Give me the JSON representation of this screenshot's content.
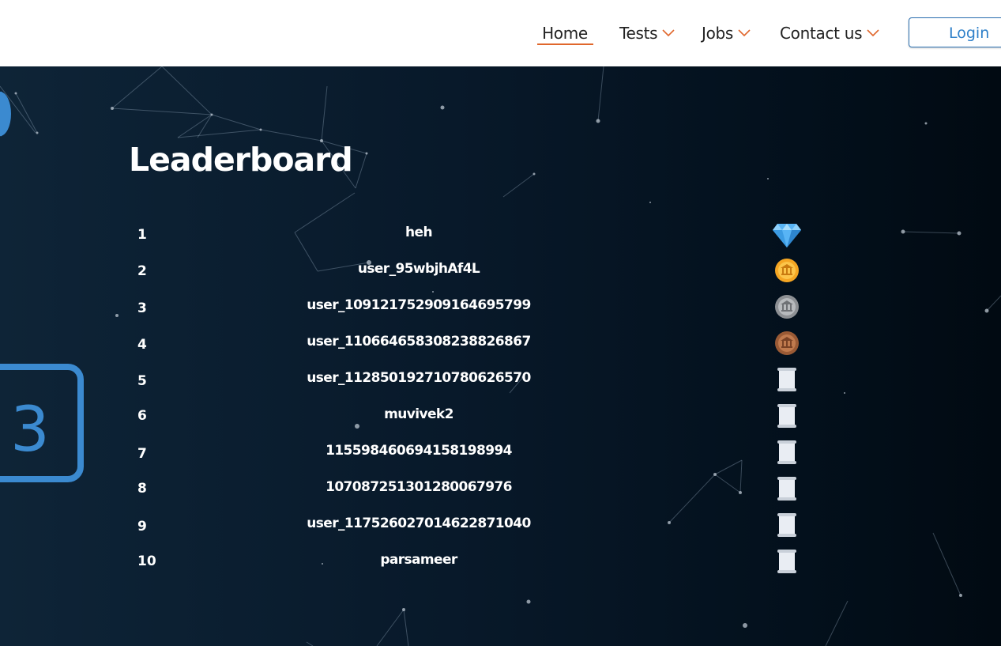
{
  "nav": {
    "home": "Home",
    "tests": "Tests",
    "jobs": "Jobs",
    "contact": "Contact us",
    "login": "Login"
  },
  "colors": {
    "accent": "#e0672c",
    "login_blue": "#2f80c9",
    "hero_bg": "#08192a"
  },
  "hero_graphic_digit": "3",
  "page": {
    "title": "Leaderboard"
  },
  "leaderboard": [
    {
      "rank": "1",
      "name": "heh",
      "badge": "diamond-icon"
    },
    {
      "rank": "2",
      "name": "user_95wbjhAf4L",
      "badge": "gold-coin-icon"
    },
    {
      "rank": "3",
      "name": "user_109121752909164695799",
      "badge": "silver-coin-icon"
    },
    {
      "rank": "4",
      "name": "user_110664658308238826867",
      "badge": "bronze-coin-icon"
    },
    {
      "rank": "5",
      "name": "user_112850192710780626570",
      "badge": "scroll-icon"
    },
    {
      "rank": "6",
      "name": "muvivek2",
      "badge": "scroll-icon"
    },
    {
      "rank": "7",
      "name": "115598460694158198994",
      "badge": "scroll-icon"
    },
    {
      "rank": "8",
      "name": "107087251301280067976",
      "badge": "scroll-icon"
    },
    {
      "rank": "9",
      "name": "user_117526027014622871040",
      "badge": "scroll-icon"
    },
    {
      "rank": "10",
      "name": "parsameer",
      "badge": "scroll-icon"
    }
  ]
}
